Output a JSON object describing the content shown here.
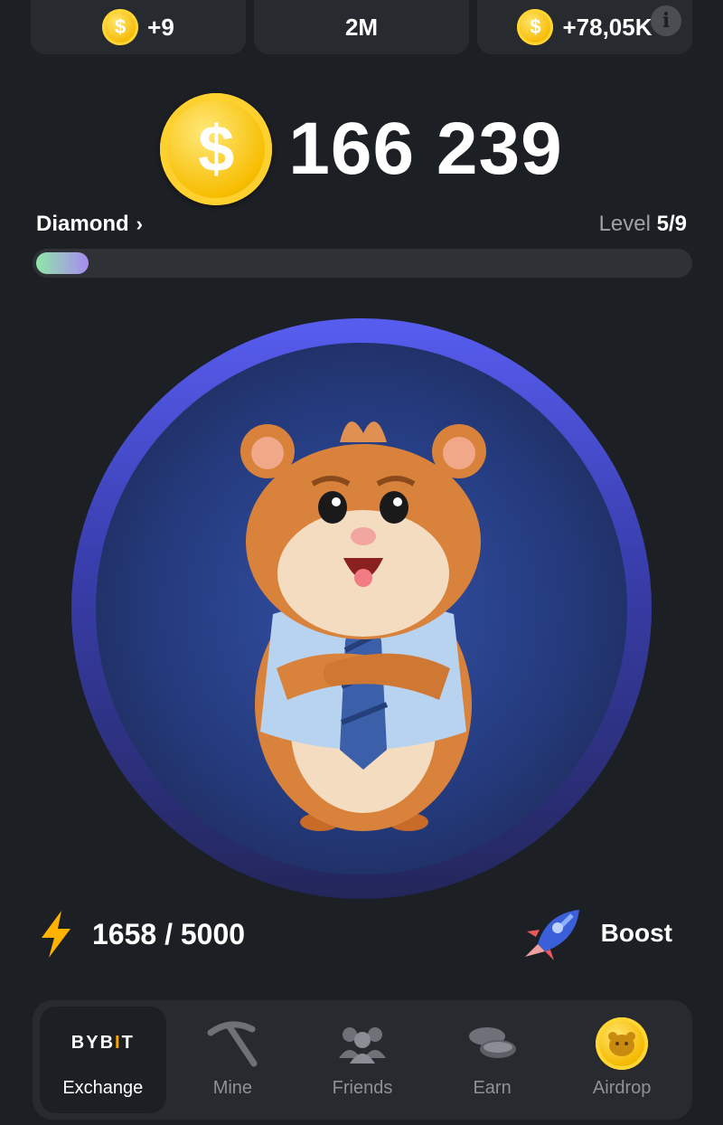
{
  "stats": {
    "tap_value": "+9",
    "level_up_value": "2M",
    "profit_per_hour": "+78,05K",
    "coin_symbol": "$",
    "info_symbol": "i"
  },
  "balance": {
    "value": "166 239",
    "coin_symbol": "$"
  },
  "league": {
    "name": "Diamond",
    "chevron": "›"
  },
  "level": {
    "label": "Level",
    "value": "5/9",
    "progress_fraction": 0.08
  },
  "energy": {
    "value": "1658 / 5000",
    "icon": "lightning-icon"
  },
  "boost": {
    "label": "Boost",
    "icon": "rocket-icon"
  },
  "nav": {
    "items": [
      {
        "label": "Exchange",
        "icon": "bybit-logo",
        "logo_text": "BYB",
        "logo_bar": "I",
        "logo_end": "T",
        "active": true
      },
      {
        "label": "Mine",
        "icon": "pickaxe-icon",
        "active": false
      },
      {
        "label": "Friends",
        "icon": "friends-icon",
        "active": false
      },
      {
        "label": "Earn",
        "icon": "coins-icon",
        "active": false
      },
      {
        "label": "Airdrop",
        "icon": "hamster-coin-icon",
        "active": false
      }
    ]
  },
  "colors": {
    "background": "#1c1f24",
    "card": "#272a2f",
    "accent_purple": "#575def",
    "coin_gold": "#f7bd00",
    "bybit_orange": "#f7a600"
  }
}
